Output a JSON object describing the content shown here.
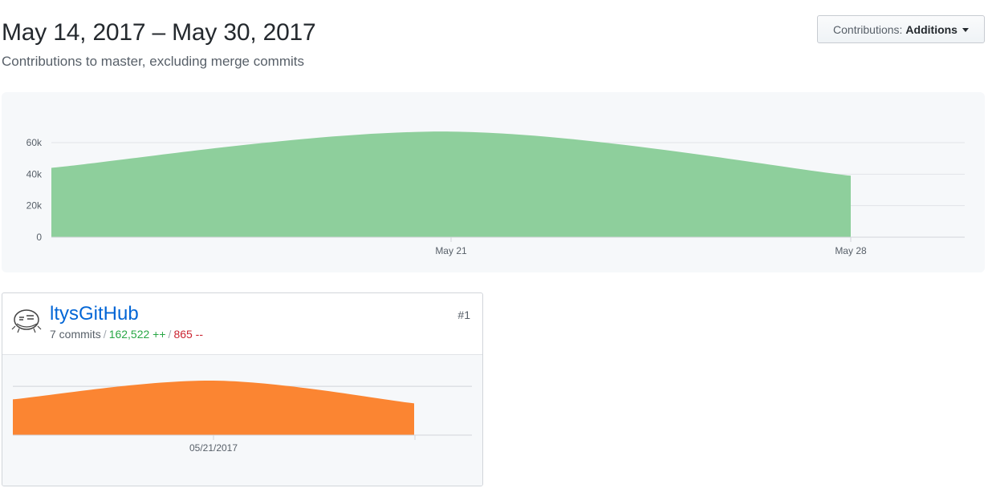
{
  "header": {
    "title": "May 14, 2017 – May 30, 2017",
    "subtitle": "Contributions to master, excluding merge commits"
  },
  "contrib_select": {
    "label": "Contributions:",
    "selected": "Additions"
  },
  "colors": {
    "main_area": "#8ecf9c",
    "user_area": "#fb8532",
    "username_link": "#0366d6",
    "additions": "#28a745",
    "deletions": "#cb2431"
  },
  "chart_data": [
    {
      "type": "area",
      "x_label": "",
      "y_label": "",
      "y_ticks": [
        "60k",
        "40k",
        "20k",
        "0"
      ],
      "y_tick_values": [
        60000,
        40000,
        20000,
        0
      ],
      "x_ticks": [
        "May 21",
        "May 28"
      ],
      "ylim": [
        0,
        60000
      ],
      "grid": true,
      "series": [
        {
          "x": [
            "2017-05-14",
            "2017-05-21",
            "2017-05-28"
          ],
          "values": [
            44000,
            67000,
            39000
          ]
        }
      ]
    },
    {
      "type": "area",
      "x_ticks": [
        "05/21/2017"
      ],
      "grid": true,
      "series": [
        {
          "x": [
            "2017-05-14",
            "2017-05-21",
            "2017-05-28"
          ],
          "values": [
            44000,
            67000,
            39000
          ]
        }
      ]
    }
  ],
  "contributor": {
    "name": "ltysGitHub",
    "commits": "7 commits",
    "additions": "162,522 ++",
    "deletions": "865 --",
    "rank": "#1",
    "avatar_icon": "avatar-icon"
  }
}
